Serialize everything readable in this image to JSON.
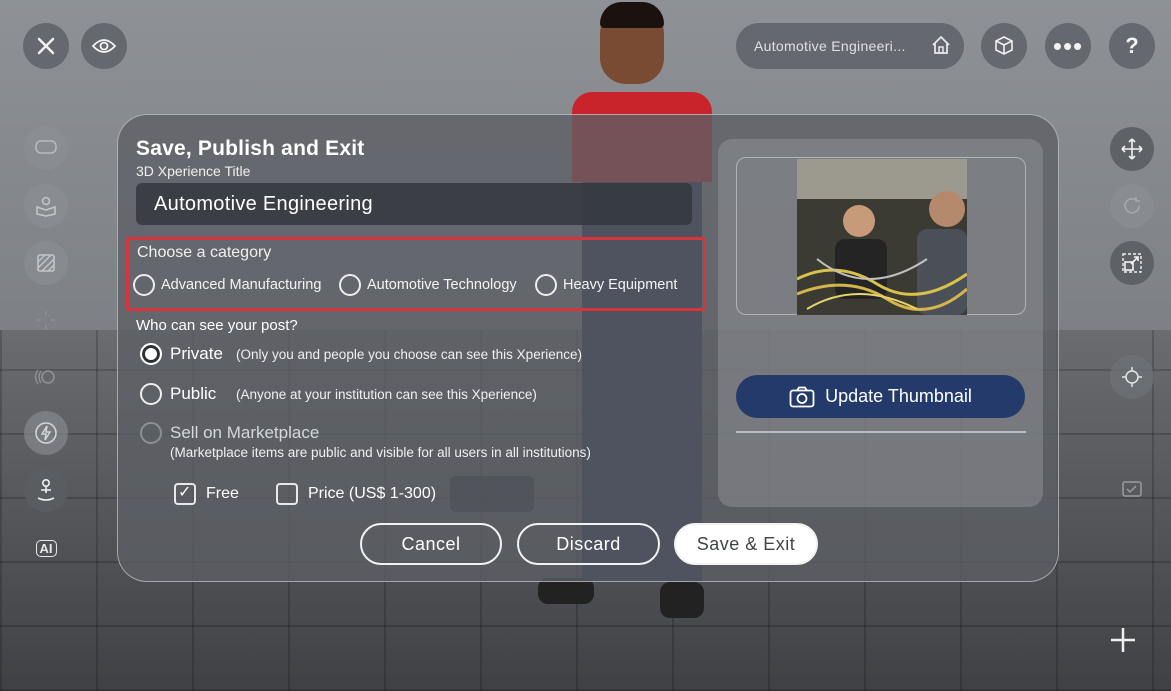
{
  "location": {
    "label": "Automotive Engineeri..."
  },
  "dialog": {
    "title": "Save, Publish and Exit",
    "title_field_label": "3D Xperience Title",
    "title_value": "Automotive Engineering",
    "category": {
      "label": "Choose a category",
      "options": [
        "Advanced Manufacturing",
        "Automotive Technology",
        "Heavy Equipment"
      ]
    },
    "visibility": {
      "label": "Who can see your post?",
      "private": {
        "name": "Private",
        "desc": "(Only you and people you choose can see this Xperience)"
      },
      "public": {
        "name": "Public",
        "desc": "(Anyone at your institution can see this Xperience)"
      },
      "market": {
        "name": "Sell on Marketplace",
        "desc": "(Marketplace items are public and visible for all users in all institutions)"
      },
      "free_label": "Free",
      "price_label": "Price (US$ 1-300)"
    },
    "buttons": {
      "cancel": "Cancel",
      "discard": "Discard",
      "save": "Save & Exit"
    },
    "thumbnail": {
      "update_label": "Update Thumbnail"
    }
  },
  "side": {
    "ai_label": "AI"
  },
  "colors": {
    "accent": "#243a6b",
    "highlight": "#d8343e"
  }
}
